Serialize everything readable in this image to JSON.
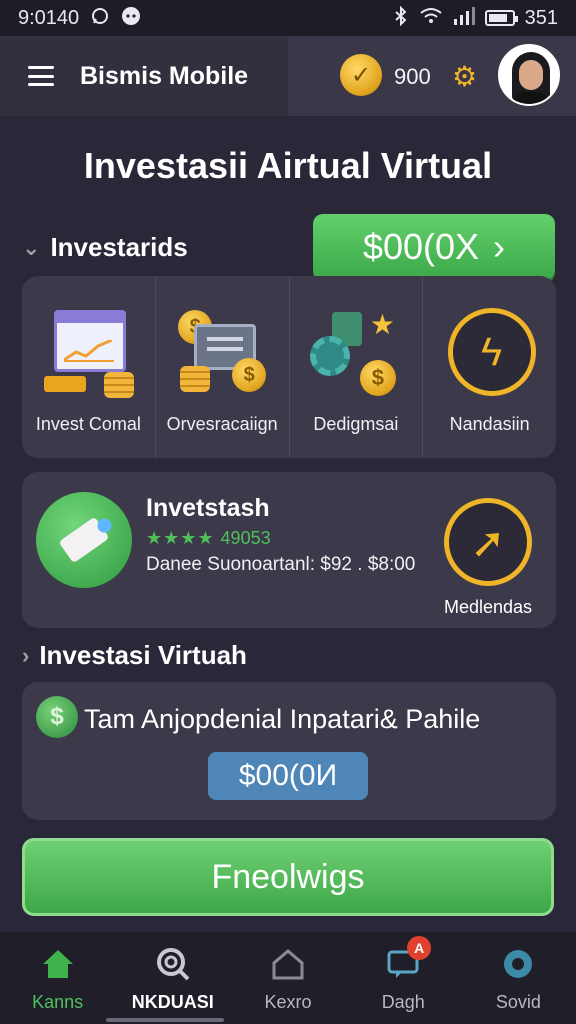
{
  "status_bar": {
    "time": "9:0140",
    "icons_left": [
      "whatsapp-icon",
      "chat-icon"
    ],
    "icons_right": [
      "bluetooth-icon",
      "wifi-icon",
      "signal-icon",
      "battery-icon"
    ],
    "battery_text": "351"
  },
  "header": {
    "title": "Bismis Mobile",
    "coins": "900"
  },
  "page_title": "Investasii Airtual Virtual",
  "section1": {
    "heading": "Investarids",
    "cta_amount": "$00(0X",
    "cta_arrow": "›"
  },
  "categories": [
    {
      "label": "Invest Comal"
    },
    {
      "label": "Orvesracaiign"
    },
    {
      "label": "Dedigmsai"
    },
    {
      "label": "Nandasiin"
    }
  ],
  "product": {
    "title": "Invetstash",
    "stars": "★★★★",
    "rating": "49053",
    "desc": "Danee Suonoartanl: $92 . $8:00",
    "action_label": "Medlendas"
  },
  "section2": {
    "heading": "Investasi Virtuah"
  },
  "deal": {
    "coin_symbol": "$",
    "text": "Tam Anjopdenial Inpatari& Pahile",
    "amount": "$00(0И"
  },
  "primary_button": {
    "label": "Fneolwigs"
  },
  "bottom_nav": [
    {
      "label": "Kanns"
    },
    {
      "label": "NKDUASI"
    },
    {
      "label": "Kexro"
    },
    {
      "label": "Dagh",
      "badge": "A"
    },
    {
      "label": "Sovid"
    }
  ],
  "colors": {
    "background": "#2a2838",
    "card": "#3b394a",
    "accent_green": "#3fb24c",
    "accent_gold": "#f0b429",
    "amount_blue": "#4f86b8"
  }
}
